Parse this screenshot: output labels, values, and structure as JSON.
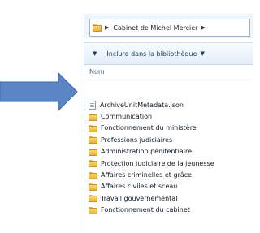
{
  "address": {
    "path": [
      "Cabinet de Michel Mercier"
    ]
  },
  "toolbar": {
    "include_label": "Inclure dans la bibliothèque"
  },
  "columns": {
    "name_label": "Nom"
  },
  "items": [
    {
      "label": "ArchiveUnitMetadata.json",
      "icon": "file-icon"
    },
    {
      "label": "Communication",
      "icon": "folder-icon"
    },
    {
      "label": "Fonctionnement du ministère",
      "icon": "folder-icon"
    },
    {
      "label": "Professions judiciaires",
      "icon": "folder-icon"
    },
    {
      "label": "Administration pénitentiaire",
      "icon": "folder-icon"
    },
    {
      "label": "Protection judiciaire de la jeunesse",
      "icon": "folder-icon"
    },
    {
      "label": "Affaires criminelles et grâce",
      "icon": "folder-icon"
    },
    {
      "label": "Affaires civiles et sceau",
      "icon": "folder-icon"
    },
    {
      "label": "Travail gouvernemental",
      "icon": "folder-icon"
    },
    {
      "label": "Fonctionnement du cabinet",
      "icon": "folder-icon"
    }
  ],
  "colors": {
    "arrow_fill": "#5b86c6",
    "arrow_stroke": "#3d6aa8",
    "folder": "#f2c55c"
  }
}
